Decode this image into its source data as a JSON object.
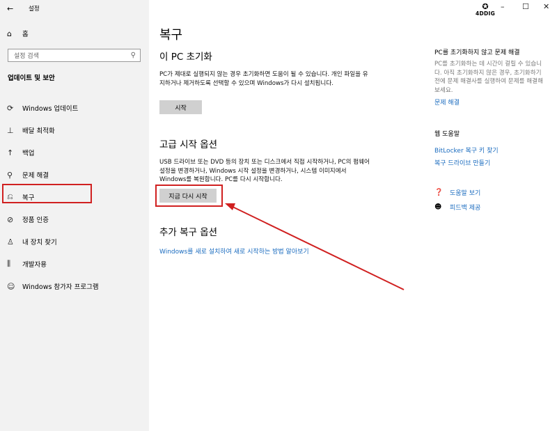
{
  "window": {
    "back_icon": "back-arrow-icon",
    "title": "설정",
    "minimize": "–",
    "maximize": "☐",
    "close": "✕",
    "logo_text": "4DDIG"
  },
  "sidebar": {
    "home_label": "홈",
    "search_placeholder": "설정 검색",
    "section_title": "업데이트 및 보안",
    "items": [
      {
        "icon": "sync-icon",
        "label": "Windows 업데이트"
      },
      {
        "icon": "delivery-icon",
        "label": "배달 최적화"
      },
      {
        "icon": "backup-icon",
        "label": "백업"
      },
      {
        "icon": "wrench-icon",
        "label": "문제 해결"
      },
      {
        "icon": "recovery-icon",
        "label": "복구"
      },
      {
        "icon": "check-circle-icon",
        "label": "정품 인증"
      },
      {
        "icon": "find-device-icon",
        "label": "내 장치 찾기"
      },
      {
        "icon": "developer-icon",
        "label": "개발자용"
      },
      {
        "icon": "insider-icon",
        "label": "Windows 참가자 프로그램"
      }
    ]
  },
  "main": {
    "page_title": "복구",
    "reset": {
      "heading": "이 PC 초기화",
      "description": "PC가 제대로 실행되지 않는 경우 초기화하면 도움이 될 수 있습니다. 개인 파일을 유지하거나 제거하도록 선택할 수 있으며 Windows가 다시 설치됩니다.",
      "button": "시작"
    },
    "advanced": {
      "heading": "고급 시작 옵션",
      "description": "USB 드라이브 또는 DVD 등의 장치 또는 디스크에서 직접 시작하거나, PC의 펌웨어 설정을 변경하거나, Windows 시작 설정을 변경하거나, 시스템 이미지에서 Windows를 복원합니다. PC를 다시 시작합니다.",
      "button": "지금 다시 시작"
    },
    "more": {
      "heading": "추가 복구 옵션",
      "link": "Windows를 새로 설치하여 새로 시작하는 방법 알아보기"
    }
  },
  "right_panel": {
    "title": "PC를 초기화하지 않고 문제 해결",
    "text": "PC를 초기화하는 데 시간이 걸릴 수 있습니다. 아직 초기화하지 않은 경우, 초기화하기 전에 문제 해결사를 실행하여 문제를 해결해 보세요.",
    "troubleshoot_link": "문제 해결",
    "web_help_title": "웹 도움말",
    "bitlocker_link": "BitLocker 복구 키 찾기",
    "drive_link": "복구 드라이브 만들기",
    "get_help": "도움말 보기",
    "feedback": "피드백 제공"
  },
  "colors": {
    "sidebar_bg": "#f2f2f2",
    "accent_link": "#1a6bbf",
    "annotation_red": "#d02020",
    "button_bg": "#d0d0d0"
  }
}
